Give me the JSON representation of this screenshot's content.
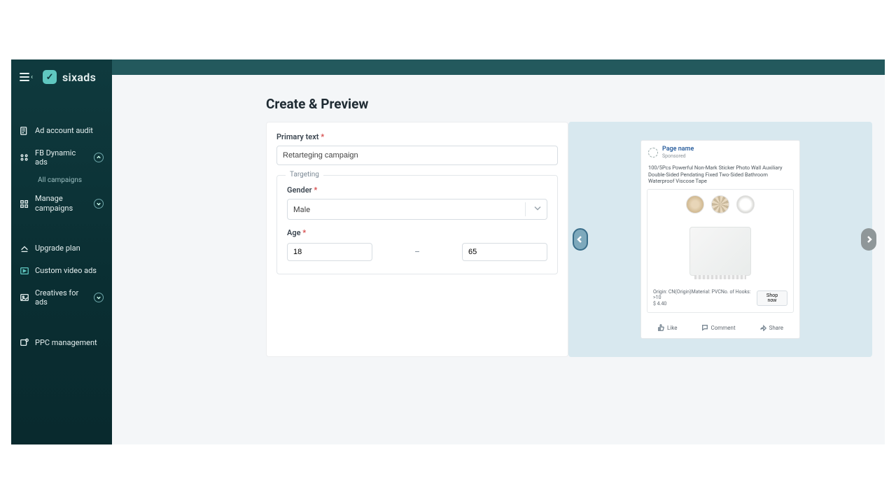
{
  "brand": {
    "name": "sixads"
  },
  "sidebar": {
    "items": [
      {
        "label": "Ad account audit"
      },
      {
        "label": "FB Dynamic ads",
        "expanded": true,
        "sub": [
          {
            "label": "All campaigns"
          }
        ]
      },
      {
        "label": "Manage campaigns",
        "expanded": false
      },
      {
        "label": "Upgrade plan"
      },
      {
        "label": "Custom video ads"
      },
      {
        "label": "Creatives for ads",
        "expanded": false
      },
      {
        "label": "PPC management"
      }
    ]
  },
  "page": {
    "title": "Create & Preview"
  },
  "form": {
    "primary_text_label": "Primary text",
    "primary_text_value": "Retarteging campaign",
    "targeting_legend": "Targeting",
    "gender_label": "Gender",
    "gender_value": "Male",
    "age_label": "Age",
    "age_min": "18",
    "age_max": "65",
    "age_sep": "–"
  },
  "preview": {
    "page_name": "Page name",
    "sponsored": "Sponsored",
    "primary_text": "100/5Pcs Powerful Non-Mark Sticker Photo Wall Auxiliary Double-Sided Pendating Fixed Two-Sided Bathroom Waterproof Viscose Tape",
    "details": "Origin: CN(Origin)Material: PVCNo. of Hooks: >10",
    "price": "$ 4.40",
    "cta": "Shop now",
    "actions": {
      "like": "Like",
      "comment": "Comment",
      "share": "Share"
    }
  }
}
